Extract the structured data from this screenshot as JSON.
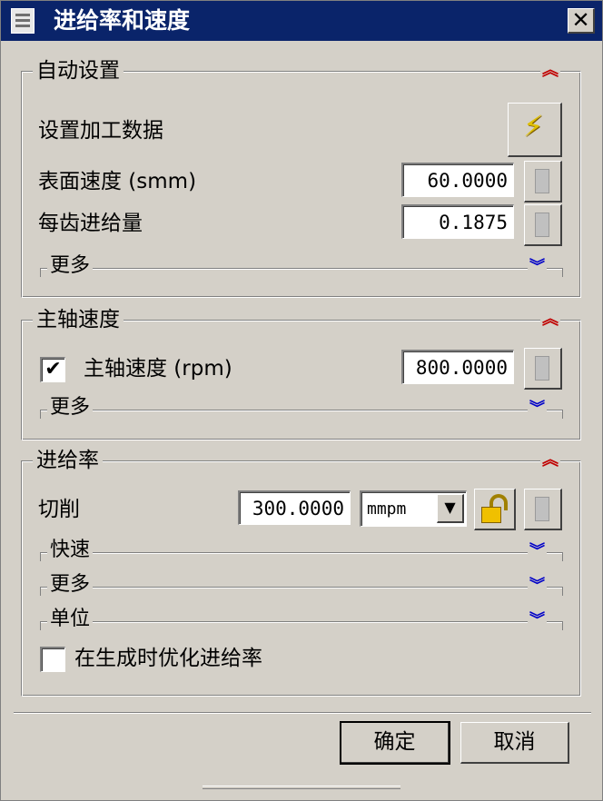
{
  "window": {
    "title": "进给率和速度",
    "close_label": "✕"
  },
  "auto_settings": {
    "title": "自动设置",
    "set_machining_data_label": "设置加工数据",
    "surface_speed_label": "表面速度 (smm)",
    "surface_speed_value": "60.0000",
    "feed_per_tooth_label": "每齿进给量",
    "feed_per_tooth_value": "0.1875",
    "more_label": "更多"
  },
  "spindle": {
    "title": "主轴速度",
    "checkbox_checked": true,
    "check_mark": "✔",
    "speed_label": "主轴速度 (rpm)",
    "speed_value": "800.0000",
    "more_label": "更多"
  },
  "feed_rate": {
    "title": "进给率",
    "cut_label": "切削",
    "cut_value": "300.0000",
    "cut_unit": "mmpm",
    "rapid_label": "快速",
    "more_label": "更多",
    "units_label": "单位",
    "optimize_label": "在生成时优化进给率",
    "optimize_checked": false
  },
  "icons": {
    "collapse": "≈",
    "expand": "≈",
    "dropdown": "▼",
    "lightning": "⚡"
  },
  "buttons": {
    "ok": "确定",
    "cancel": "取消"
  },
  "colors": {
    "titlebar": "#0a246a",
    "collapse_arrow": "#c00000",
    "expand_arrow": "#0000c8"
  }
}
